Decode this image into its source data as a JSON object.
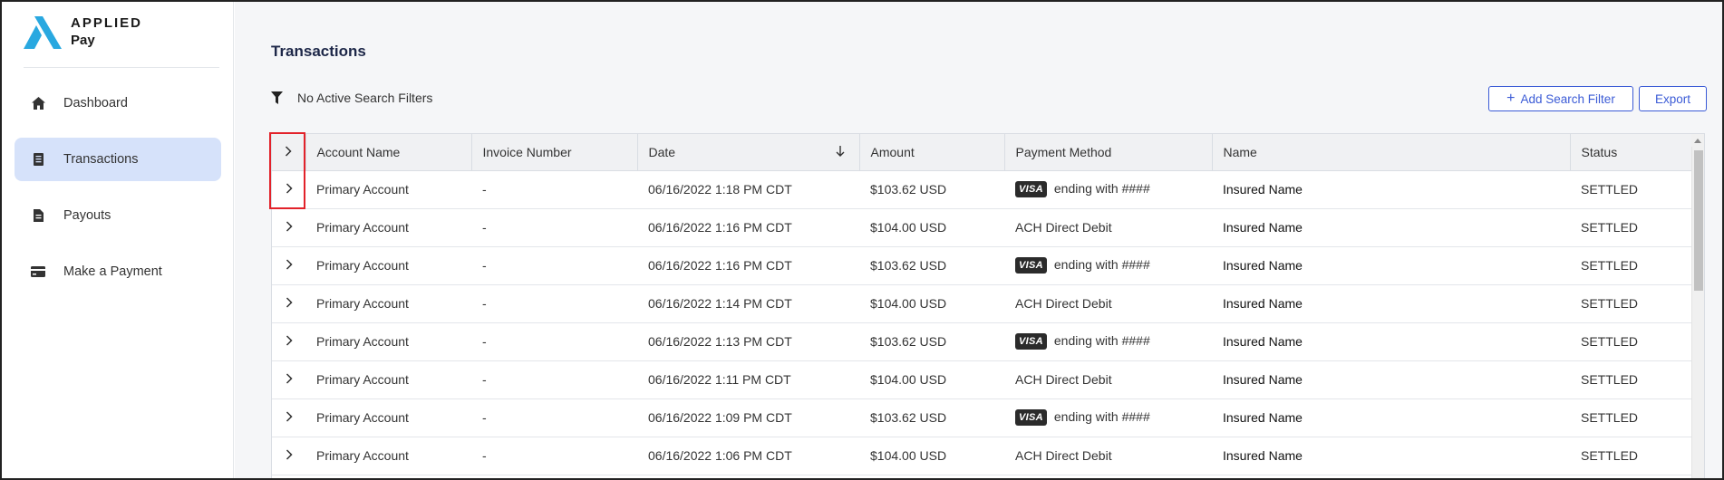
{
  "brand": {
    "line1": "APPLIED",
    "line2": "Pay",
    "colors": {
      "logo": "#29a8e0",
      "accent": "#3b5bd6",
      "active_nav": "#d6e2fa"
    }
  },
  "sidebar": {
    "items": [
      {
        "label": "Dashboard",
        "icon": "home-icon"
      },
      {
        "label": "Transactions",
        "icon": "receipt-icon",
        "active": true
      },
      {
        "label": "Payouts",
        "icon": "document-icon"
      },
      {
        "label": "Make a Payment",
        "icon": "credit-card-icon"
      }
    ]
  },
  "page": {
    "title": "Transactions",
    "filter_status": "No Active Search Filters",
    "add_filter_label": "Add Search Filter",
    "export_label": "Export"
  },
  "table": {
    "columns": [
      "Account Name",
      "Invoice Number",
      "Date",
      "Amount",
      "Payment Method",
      "Name",
      "Status"
    ],
    "sort_column": "Date",
    "rows": [
      {
        "account": "Primary Account",
        "invoice": "-",
        "date": "06/16/2022 1:18 PM CDT",
        "amount": "$103.62 USD",
        "method_type": "visa",
        "method": "ending with ####",
        "name": "Insured Name",
        "status": "SETTLED"
      },
      {
        "account": "Primary Account",
        "invoice": "-",
        "date": "06/16/2022 1:16 PM CDT",
        "amount": "$104.00 USD",
        "method_type": "ach",
        "method": "ACH Direct Debit",
        "name": "Insured Name",
        "status": "SETTLED"
      },
      {
        "account": "Primary Account",
        "invoice": "-",
        "date": "06/16/2022 1:16 PM CDT",
        "amount": "$103.62 USD",
        "method_type": "visa",
        "method": "ending with ####",
        "name": "Insured Name",
        "status": "SETTLED"
      },
      {
        "account": "Primary Account",
        "invoice": "-",
        "date": "06/16/2022 1:14 PM CDT",
        "amount": "$104.00 USD",
        "method_type": "ach",
        "method": "ACH Direct Debit",
        "name": "Insured Name",
        "status": "SETTLED"
      },
      {
        "account": "Primary Account",
        "invoice": "-",
        "date": "06/16/2022 1:13 PM CDT",
        "amount": "$103.62 USD",
        "method_type": "visa",
        "method": "ending with ####",
        "name": "Insured Name",
        "status": "SETTLED"
      },
      {
        "account": "Primary Account",
        "invoice": "-",
        "date": "06/16/2022 1:11 PM CDT",
        "amount": "$104.00 USD",
        "method_type": "ach",
        "method": "ACH Direct Debit",
        "name": "Insured Name",
        "status": "SETTLED"
      },
      {
        "account": "Primary Account",
        "invoice": "-",
        "date": "06/16/2022 1:09 PM CDT",
        "amount": "$103.62 USD",
        "method_type": "visa",
        "method": "ending with ####",
        "name": "Insured Name",
        "status": "SETTLED"
      },
      {
        "account": "Primary Account",
        "invoice": "-",
        "date": "06/16/2022 1:06 PM CDT",
        "amount": "$104.00 USD",
        "method_type": "ach",
        "method": "ACH Direct Debit",
        "name": "Insured Name",
        "status": "SETTLED"
      }
    ]
  },
  "visa_label": "VISA"
}
